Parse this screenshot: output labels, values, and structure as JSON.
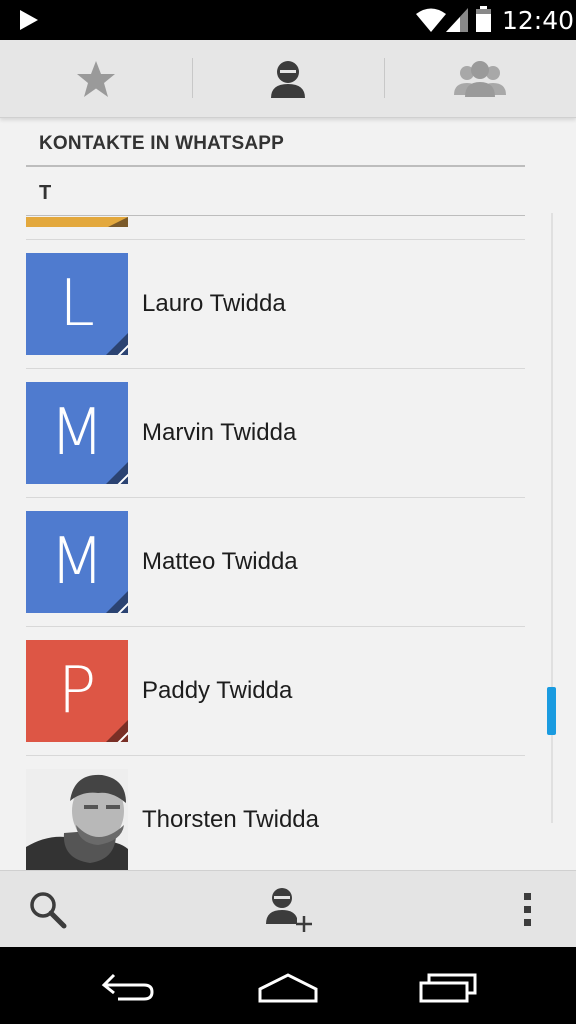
{
  "status_bar": {
    "time": "12:40",
    "icons": [
      "play-icon",
      "wifi-icon",
      "signal-icon",
      "battery-icon"
    ]
  },
  "tabs": [
    {
      "id": "favorites",
      "icon": "star-icon",
      "selected": false
    },
    {
      "id": "contacts",
      "icon": "person-icon",
      "selected": true
    },
    {
      "id": "groups",
      "icon": "group-icon",
      "selected": false
    }
  ],
  "list": {
    "section_title": "KONTAKTE IN WHATSAPP",
    "letter": "T",
    "partial_avatar_color": "#e3a83d",
    "contacts": [
      {
        "name": "Lauro Twidda",
        "initial": "L",
        "color": "#4f7bcf"
      },
      {
        "name": "Marvin Twidda",
        "initial": "M",
        "color": "#4f7bcf"
      },
      {
        "name": "Matteo Twidda",
        "initial": "M",
        "color": "#4f7bcf"
      },
      {
        "name": "Paddy Twidda",
        "initial": "P",
        "color": "#dd5645"
      },
      {
        "name": "Thorsten Twidda",
        "initial": "",
        "color": "#888888",
        "photo": true
      }
    ]
  },
  "action_bar": {
    "icons": [
      "search-icon",
      "add-contact-icon",
      "overflow-menu-icon"
    ]
  },
  "nav_bar": {
    "icons": [
      "back-icon",
      "home-icon",
      "recents-icon"
    ]
  },
  "colors": {
    "accent": "#1a9be0",
    "background": "#f2f2f2",
    "icon_gray": "#9a9a9a",
    "icon_dark": "#3c3c3c"
  }
}
